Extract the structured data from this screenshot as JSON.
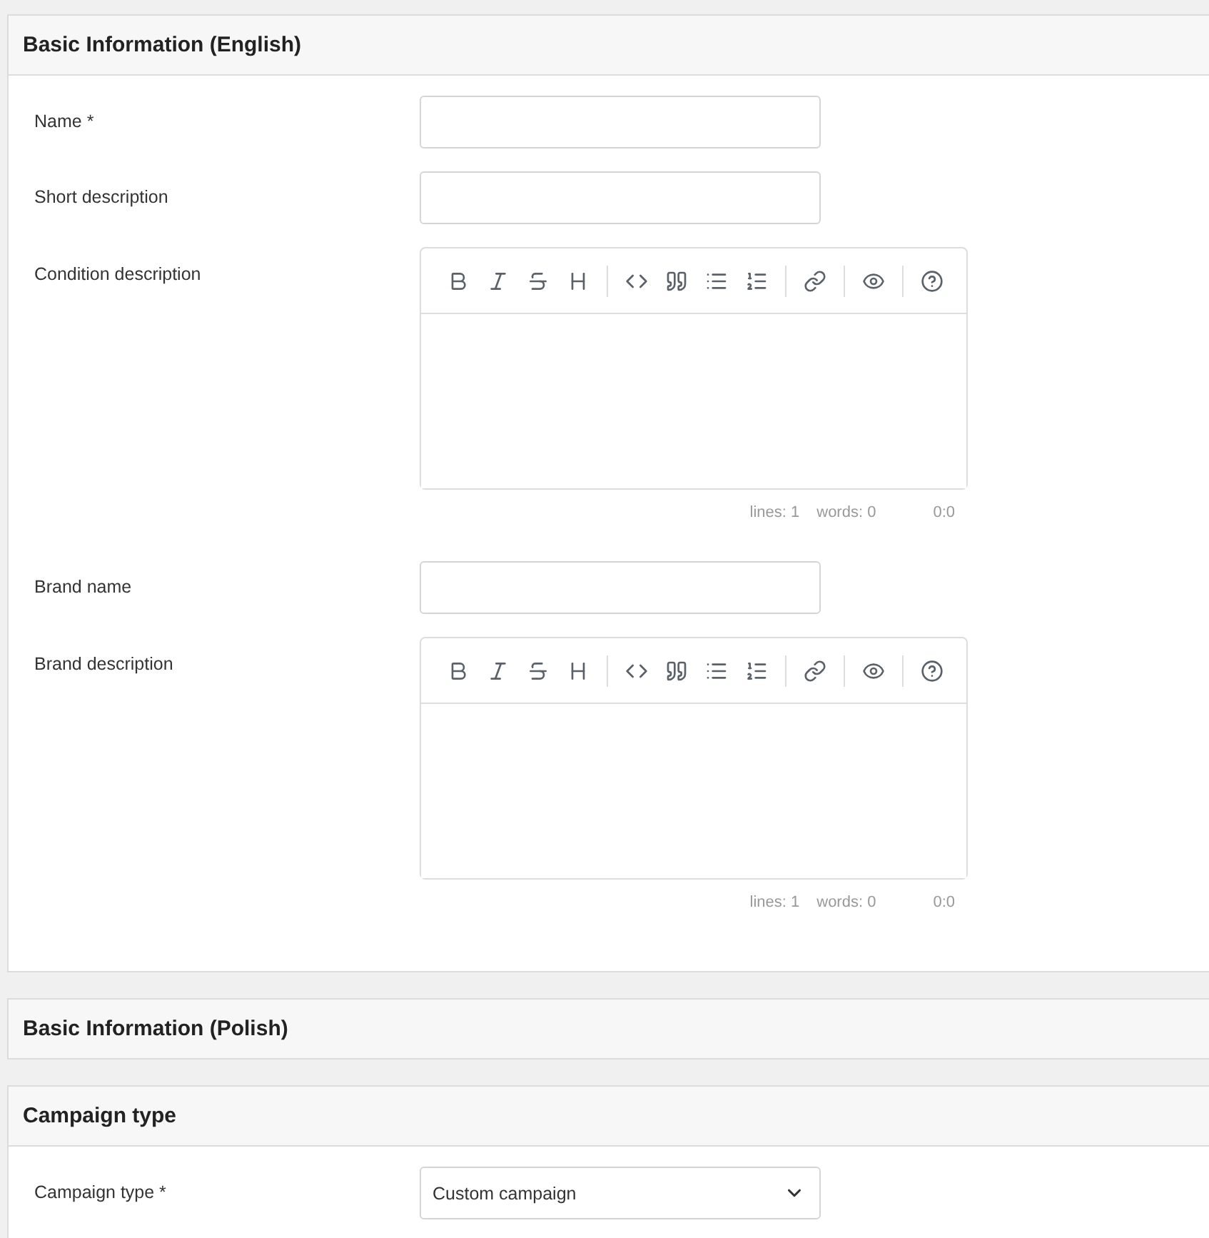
{
  "sections": [
    {
      "title": "Basic Information (English)",
      "fields": [
        {
          "kind": "text",
          "label": "Name *"
        },
        {
          "kind": "text",
          "label": "Short description"
        },
        {
          "kind": "editor",
          "label": "Condition description",
          "status": {
            "lines": "lines: 1",
            "words": "words: 0",
            "cursor": "0:0"
          }
        },
        {
          "kind": "text",
          "label": "Brand name"
        },
        {
          "kind": "editor",
          "label": "Brand description",
          "status": {
            "lines": "lines: 1",
            "words": "words: 0",
            "cursor": "0:0"
          }
        }
      ]
    },
    {
      "title": "Basic Information (Polish)"
    },
    {
      "title": "Campaign type",
      "fields": [
        {
          "kind": "select",
          "label": "Campaign type *",
          "value": "Custom campaign"
        }
      ]
    }
  ]
}
